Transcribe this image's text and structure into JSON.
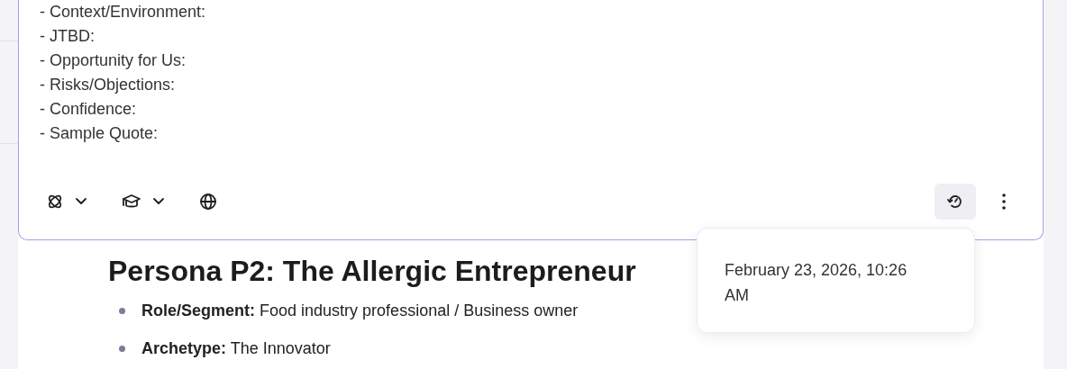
{
  "editor": {
    "lines": [
      "- Context/Environment:",
      "- JTBD:",
      "- Opportunity for Us:",
      "- Risks/Objections:",
      "- Confidence:",
      "- Sample Quote:"
    ],
    "toolbar_left": [
      {
        "kind": "atom",
        "dropdown": true
      },
      {
        "kind": "cap",
        "dropdown": true
      },
      {
        "kind": "globe",
        "dropdown": false
      }
    ],
    "toolbar_right": [
      {
        "kind": "history",
        "active": true
      },
      {
        "kind": "more",
        "active": false
      }
    ]
  },
  "tooltip": {
    "text": "February 23, 2026, 10:26 AM"
  },
  "document": {
    "heading": "Persona P2: The Allergic Entrepreneur",
    "items": [
      {
        "label": "Role/Segment:",
        "value": "Food industry professional / Business owner"
      },
      {
        "label": "Archetype:",
        "value": "The Innovator"
      }
    ]
  }
}
